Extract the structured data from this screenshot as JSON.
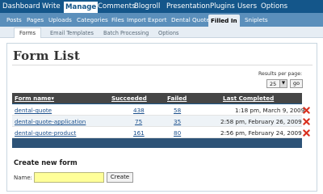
{
  "admin_menu": [
    "Dashboard",
    "Write",
    "Manage",
    "Comments",
    "Blogroll",
    "Presentation",
    "Plugins",
    "Users",
    "Options"
  ],
  "submenu": [
    "Posts",
    "Pages",
    "Uploads",
    "Categories",
    "Files",
    "Import",
    "Export",
    "Dental Quote",
    "Filled In",
    "Sniplets"
  ],
  "subsubmenu": [
    "Forms",
    "Email Templates",
    "Batch Processing",
    "Options"
  ],
  "page_title": "Form List",
  "results_per_page": {
    "label": "Results per page:",
    "value": "25",
    "go": "go"
  },
  "table": {
    "headers": {
      "form_name": "Form name▾",
      "succeeded": "Succeeded",
      "failed": "Failed",
      "last_completed": "Last Completed"
    },
    "rows": [
      {
        "name": "dental-quote",
        "succeeded": "438",
        "failed": "58",
        "last_completed": "1:18 pm, March 9, 2009"
      },
      {
        "name": "dental-quote-application",
        "succeeded": "75",
        "failed": "35",
        "last_completed": "2:58 pm, February 26, 2009"
      },
      {
        "name": "dental-quote-product",
        "succeeded": "161",
        "failed": "80",
        "last_completed": "2:56 pm, February 24, 2009"
      }
    ]
  },
  "create_form": {
    "title": "Create new form",
    "name_label": "Name:",
    "name_value": "",
    "button": "Create"
  },
  "colors": {
    "menu_bg": "#14568a",
    "submenu_bg": "#5b8fbb",
    "table_header": "#464646",
    "table_footer": "#2d5377",
    "input_bg": "#ffff99",
    "delete_red": "#d9301f"
  }
}
